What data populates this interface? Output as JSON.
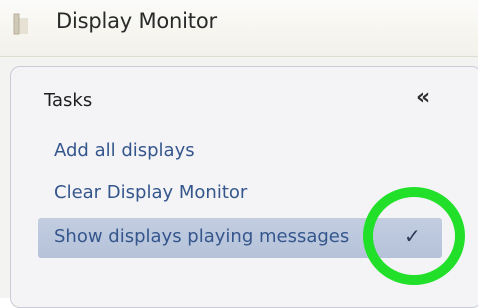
{
  "window": {
    "title": "Display Monitor",
    "icon": "monitor-window-icon"
  },
  "tasks_panel": {
    "heading": "Tasks",
    "collapse_glyph": "«",
    "items": [
      {
        "label": "Add all displays",
        "selected": false
      },
      {
        "label": "Clear Display Monitor",
        "selected": false
      },
      {
        "label": "Show displays playing messages",
        "selected": true,
        "checked": true
      }
    ],
    "check_glyph": "✓"
  },
  "annotation": {
    "highlight_color": "#22e02a"
  },
  "colors": {
    "link": "#34568c",
    "selected_row": "#b9c5da"
  }
}
